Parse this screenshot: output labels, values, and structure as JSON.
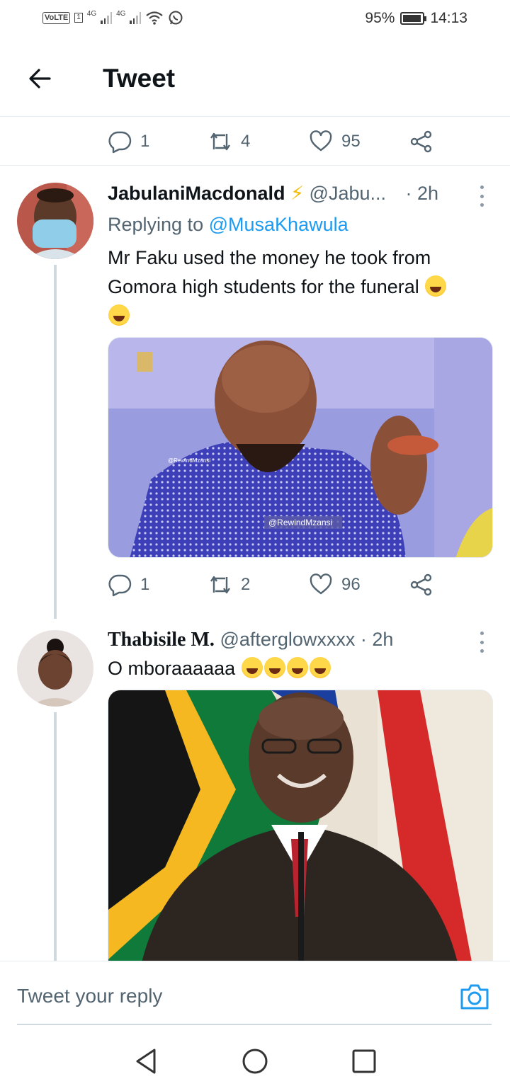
{
  "status_bar": {
    "carrier_badge": "VoLTE",
    "sim_slot": "1",
    "net1": "4G",
    "net2": "4G",
    "battery_text": "95%",
    "battery_level": 0.95,
    "time": "14:13"
  },
  "header": {
    "title": "Tweet"
  },
  "top_actions": {
    "replies": "1",
    "retweets": "4",
    "likes": "95"
  },
  "tweets": [
    {
      "display_name": "JabulaniMacdonald",
      "name_emoji": "⚡",
      "handle": "@Jabu...",
      "time": "· 2h",
      "replying_label": "Replying to",
      "replying_handle": "@MusaKhawula",
      "text": "Mr Faku used the money he took from Gomora high students for the funeral",
      "media_watermark_1": "@RewindMzansi",
      "media_watermark_2": "@RewindMzansi",
      "actions": {
        "replies": "1",
        "retweets": "2",
        "likes": "96"
      }
    },
    {
      "display_name": "Thabisile M.",
      "handle": "@afterglowxxxx",
      "time": "· 2h",
      "text": "O mboraaaaaa"
    }
  ],
  "reply_bar": {
    "placeholder": "Tweet your reply"
  },
  "icons": {
    "back": "arrow-left-icon",
    "reply": "speech-bubble-icon",
    "retweet": "retweet-icon",
    "like": "heart-icon",
    "share": "share-icon",
    "more": "vertical-ellipsis-icon",
    "camera": "camera-icon",
    "nav_back": "triangle-back-icon",
    "nav_home": "circle-home-icon",
    "nav_recent": "square-recents-icon"
  },
  "colors": {
    "accent": "#1d9bf0",
    "text": "#0f1419",
    "secondary_text": "#536471",
    "divider": "#e6ecf0"
  }
}
